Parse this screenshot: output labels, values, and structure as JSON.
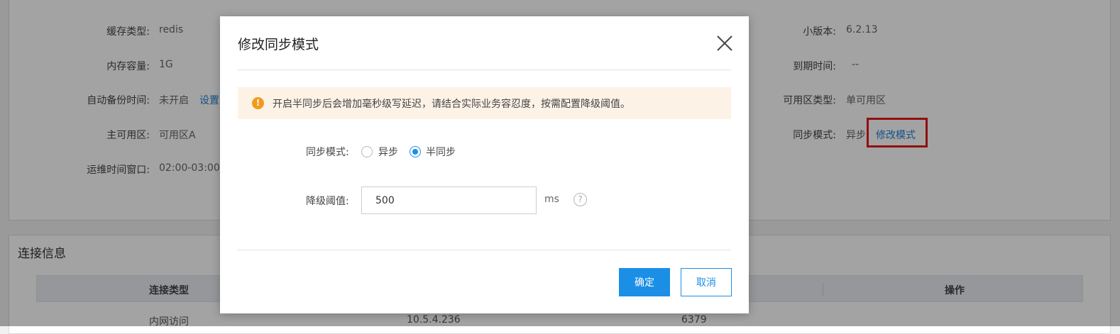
{
  "background": {
    "left_info": [
      {
        "label": "缓存类型:",
        "value": "redis"
      },
      {
        "label": "内存容量:",
        "value": "1G"
      },
      {
        "label": "自动备份时间:",
        "value": "未开启",
        "link": "设置"
      },
      {
        "label": "主可用区:",
        "value": "可用区A"
      },
      {
        "label": "运维时间窗口:",
        "value": "02:00-03:00"
      }
    ],
    "right_info": [
      {
        "label": "小版本:",
        "value": "6.2.13"
      },
      {
        "label": "到期时间:",
        "value": "--"
      },
      {
        "label": "可用区类型:",
        "value": "单可用区"
      },
      {
        "label": "同步模式:",
        "value": "异步",
        "link": "修改模式"
      }
    ],
    "connection_section_title": "连接信息",
    "table": {
      "headers": [
        "连接类型",
        "操作"
      ],
      "row": [
        "内网访问",
        "10.5.4.236",
        "6379"
      ]
    }
  },
  "modal": {
    "title": "修改同步模式",
    "alert_text": "开启半同步后会增加毫秒级写延迟，请结合实际业务容忍度，按需配置降级阈值。",
    "sync_mode_label": "同步模式:",
    "options": [
      {
        "label": "异步",
        "checked": false
      },
      {
        "label": "半同步",
        "checked": true
      }
    ],
    "threshold_label": "降级阈值:",
    "threshold_value": "500",
    "unit": "ms",
    "help_glyph": "?",
    "alert_glyph": "!",
    "confirm": "确定",
    "cancel": "取消"
  },
  "colors": {
    "primary": "#1b8fe6",
    "link": "#1f7fd1",
    "highlight": "#e21a1a",
    "alert_bg": "#fdf2e6",
    "alert_icon": "#f29a1b"
  }
}
